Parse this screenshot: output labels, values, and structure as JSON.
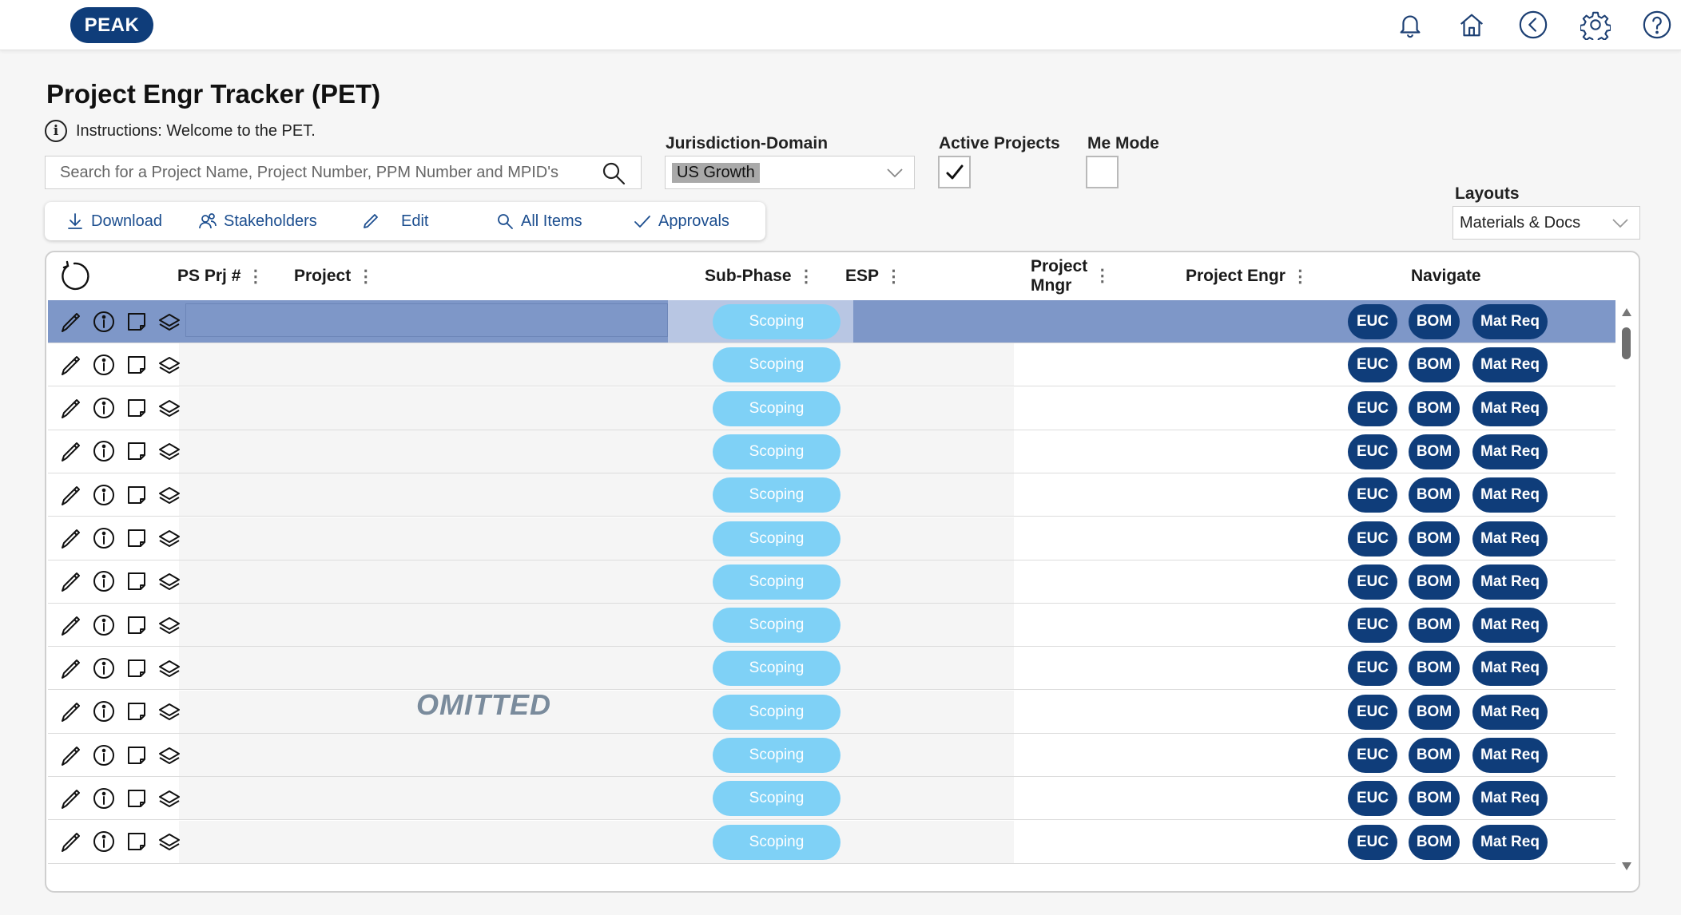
{
  "app": {
    "logo": "PEAK"
  },
  "topbar": {
    "icons": [
      "bell-icon",
      "home-icon",
      "back-icon",
      "gear-icon",
      "help-icon"
    ]
  },
  "page": {
    "title": "Project Engr Tracker (PET)",
    "instructions": "Instructions: Welcome to the PET.",
    "info_glyph": "i"
  },
  "search": {
    "placeholder": "Search for a Project Name, Project Number, PPM Number and MPID's"
  },
  "filters": {
    "jurisdiction_label": "Jurisdiction-Domain",
    "jurisdiction_value": "US Growth",
    "active_projects_label": "Active Projects",
    "active_projects_checked": true,
    "me_mode_label": "Me Mode",
    "me_mode_checked": false,
    "layouts_label": "Layouts",
    "layouts_value": "Materials & Docs"
  },
  "commands": {
    "download": "Download",
    "stakeholders": "Stakeholders",
    "edit": "Edit",
    "all_items": "All Items",
    "approvals": "Approvals"
  },
  "table": {
    "headers": {
      "ps_prj": "PS Prj #",
      "project": "Project",
      "sub_phase": "Sub-Phase",
      "esp": "ESP",
      "project_mngr_line1": "Project",
      "project_mngr_line2": "Mngr",
      "project_engr": "Project Engr",
      "navigate": "Navigate"
    },
    "header_menu_glyph": "⋮",
    "omitted_label": "OMITTED",
    "nav_labels": {
      "euc": "EUC",
      "bom": "BOM",
      "mat_req": "Mat Req"
    },
    "rows": [
      {
        "sub_phase": "Scoping",
        "selected": true
      },
      {
        "sub_phase": "Scoping",
        "selected": false
      },
      {
        "sub_phase": "Scoping",
        "selected": false
      },
      {
        "sub_phase": "Scoping",
        "selected": false
      },
      {
        "sub_phase": "Scoping",
        "selected": false
      },
      {
        "sub_phase": "Scoping",
        "selected": false
      },
      {
        "sub_phase": "Scoping",
        "selected": false
      },
      {
        "sub_phase": "Scoping",
        "selected": false
      },
      {
        "sub_phase": "Scoping",
        "selected": false
      },
      {
        "sub_phase": "Scoping",
        "selected": false
      },
      {
        "sub_phase": "Scoping",
        "selected": false
      },
      {
        "sub_phase": "Scoping",
        "selected": false
      },
      {
        "sub_phase": "Scoping",
        "selected": false
      }
    ]
  },
  "colors": {
    "brand_navy": "#0f3d7a",
    "subphase_pill": "#7fd1f6",
    "selected_row": "#7e97c8",
    "command_text": "#1c4e8f"
  }
}
